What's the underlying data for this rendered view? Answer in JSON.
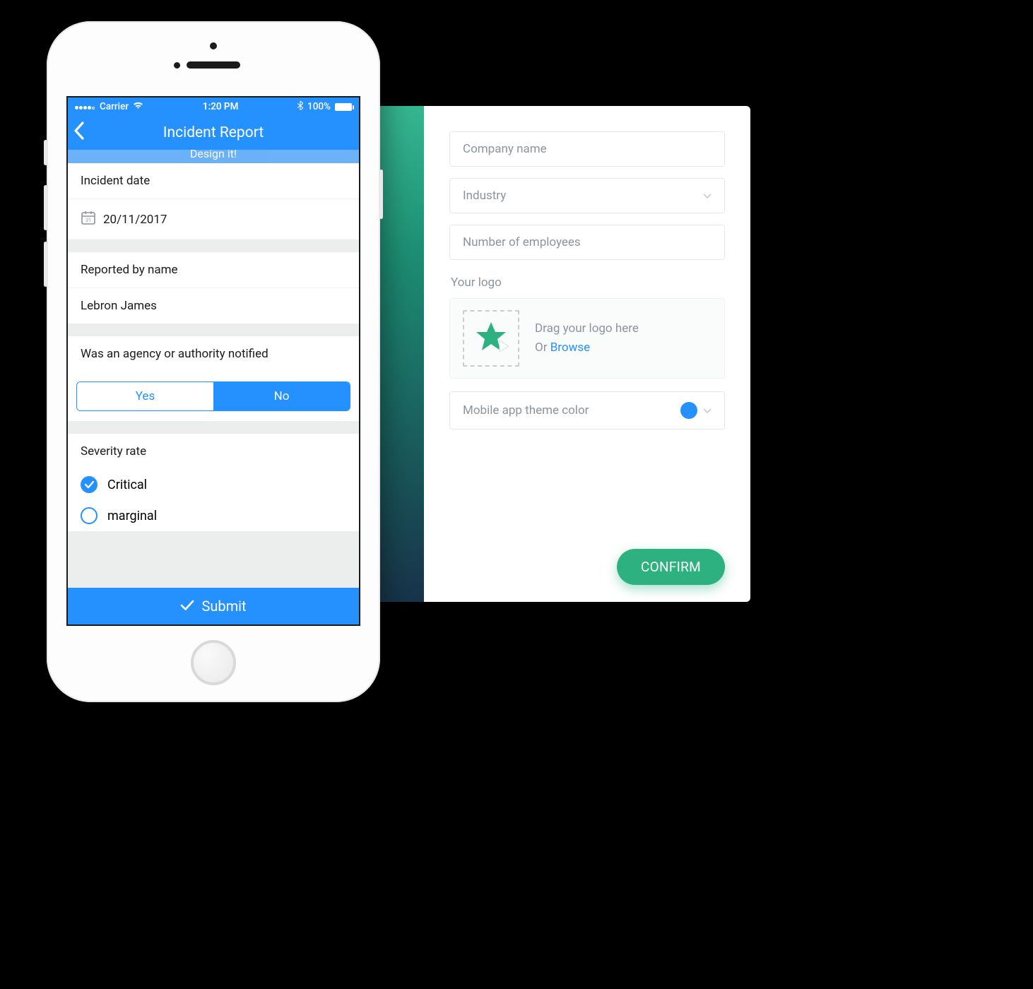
{
  "phone": {
    "statusbar": {
      "carrier": "Carrier",
      "time": "1:20 PM",
      "battery": "100%"
    },
    "header": {
      "title": "Incident Report",
      "subtitle": "Design it!"
    },
    "sections": {
      "incidentDate": {
        "label": "Incident date",
        "value": "20/11/2017"
      },
      "reportedBy": {
        "label": "Reported by name",
        "value": "Lebron James"
      },
      "notified": {
        "label": "Was an agency or authority notified",
        "yes": "Yes",
        "no": "No"
      },
      "severity": {
        "label": "Severity rate",
        "options": [
          {
            "label": "Critical",
            "selected": true
          },
          {
            "label": "marginal",
            "selected": false
          }
        ]
      }
    },
    "submit": "Submit"
  },
  "desktop": {
    "company_placeholder": "Company name",
    "industry_placeholder": "Industry",
    "employees_placeholder": "Number of employees",
    "logo_label": "Your logo",
    "drag_text": "Drag your logo here",
    "or": "Or",
    "browse": "Browse",
    "theme_label": "Mobile app theme color",
    "theme_color": "#2491ff",
    "confirm": "CONFIRM"
  }
}
